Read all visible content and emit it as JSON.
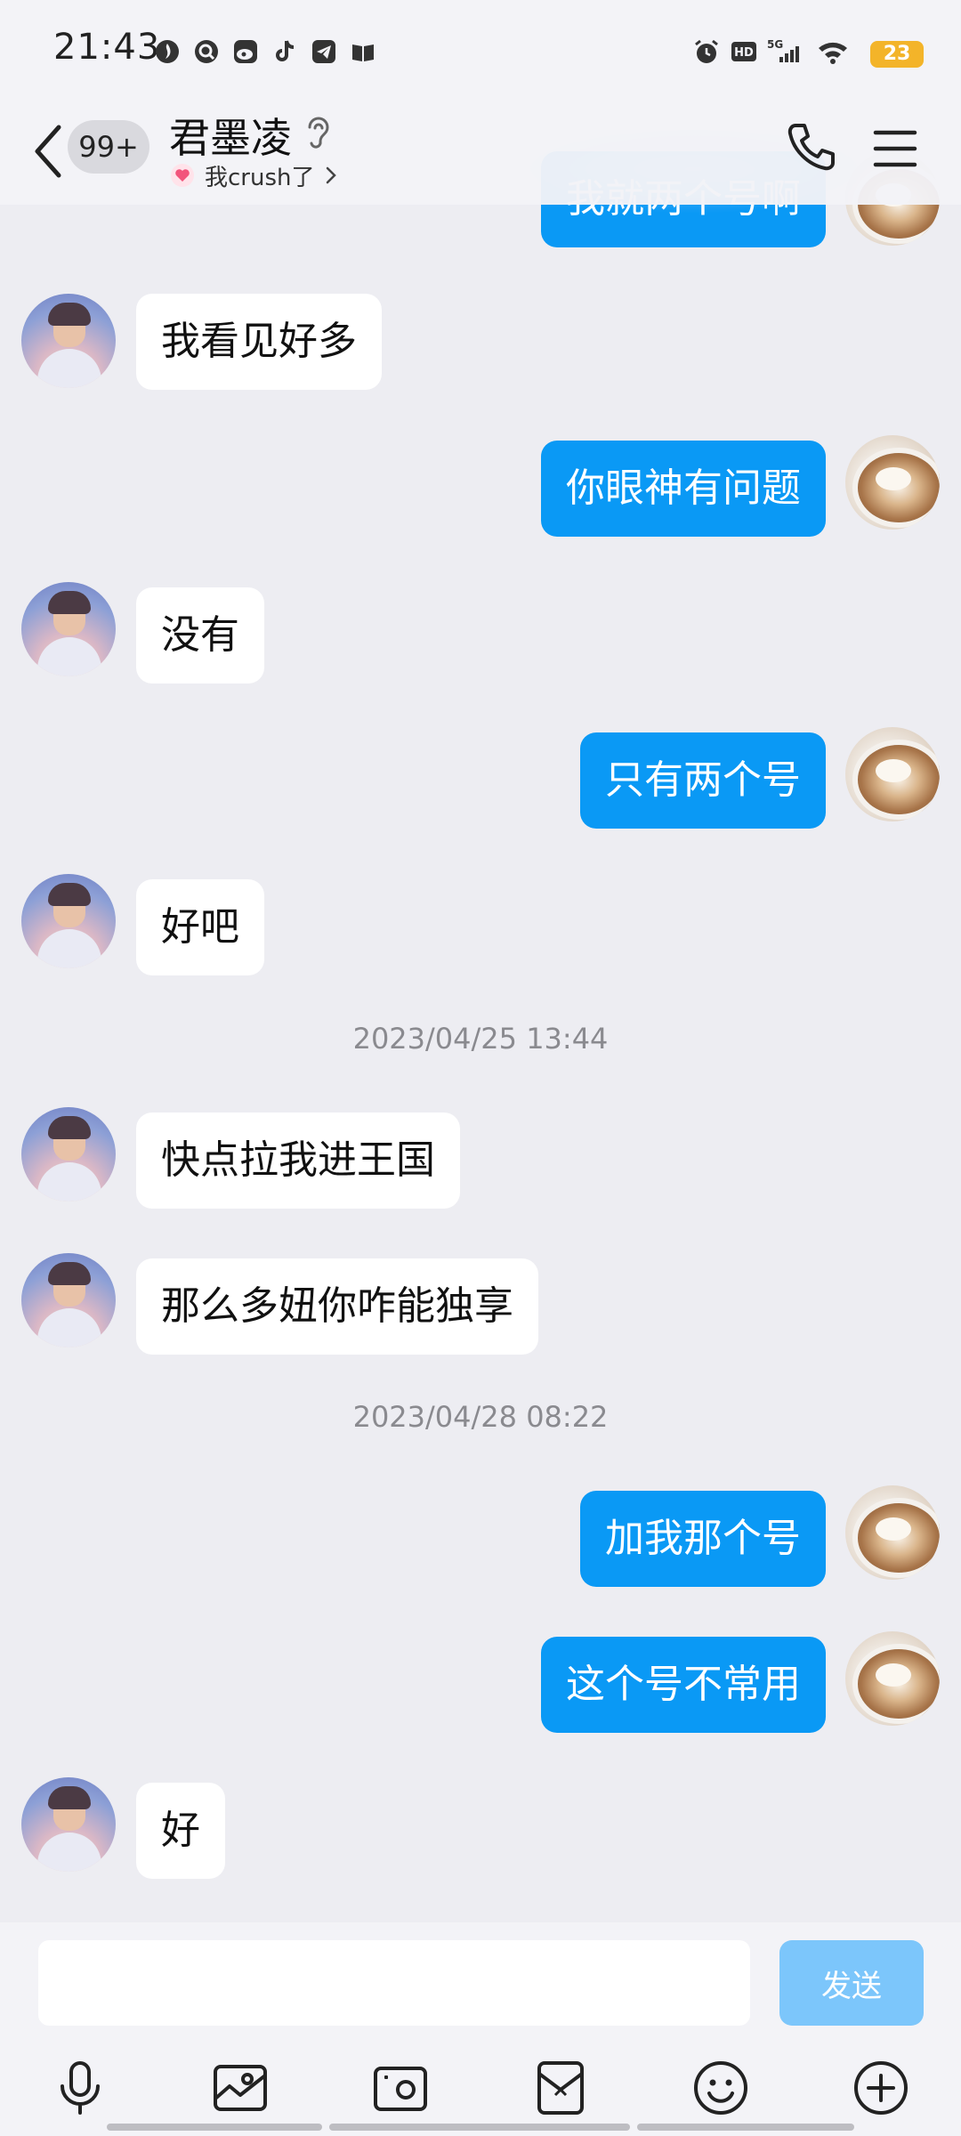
{
  "status_bar": {
    "time": "21:43",
    "battery": "23",
    "icons": [
      "hot-icon",
      "search-app-icon",
      "weibo-icon",
      "tiktok-icon",
      "telegram-icon",
      "book-icon",
      "alarm-icon",
      "hd-icon",
      "5g-signal-icon",
      "wifi-icon",
      "battery-icon"
    ]
  },
  "header": {
    "unread_count": "99+",
    "contact_name": "君墨凌",
    "subtitle": "我crush了",
    "icons": [
      "back-icon",
      "ear-icon",
      "heart-icon",
      "chevron-right-icon",
      "phone-icon",
      "menu-icon"
    ]
  },
  "messages": [
    {
      "side": "out",
      "text": "我就两个号啊"
    },
    {
      "side": "in",
      "text": "我看见好多"
    },
    {
      "side": "out",
      "text": "你眼神有问题"
    },
    {
      "side": "in",
      "text": "没有"
    },
    {
      "side": "out",
      "text": "只有两个号"
    },
    {
      "side": "in",
      "text": "好吧"
    },
    {
      "type": "timestamp",
      "text": "2023/04/25 13:44"
    },
    {
      "side": "in",
      "text": "快点拉我进王国"
    },
    {
      "side": "in",
      "text": "那么多妞你咋能独享"
    },
    {
      "type": "timestamp",
      "text": "2023/04/28 08:22"
    },
    {
      "side": "out",
      "text": "加我那个号"
    },
    {
      "side": "out",
      "text": "这个号不常用"
    },
    {
      "side": "in",
      "text": "好"
    }
  ],
  "input_bar": {
    "placeholder": "",
    "value": "",
    "send_label": "发送",
    "send_color": "#7cc6fb",
    "tools": [
      "microphone-icon",
      "gallery-icon",
      "camera-icon",
      "red-packet-icon",
      "emoji-icon",
      "plus-icon"
    ]
  },
  "colors": {
    "outgoing_bubble": "#0a99f5",
    "incoming_bubble": "#ffffff",
    "background": "#ededf2"
  }
}
